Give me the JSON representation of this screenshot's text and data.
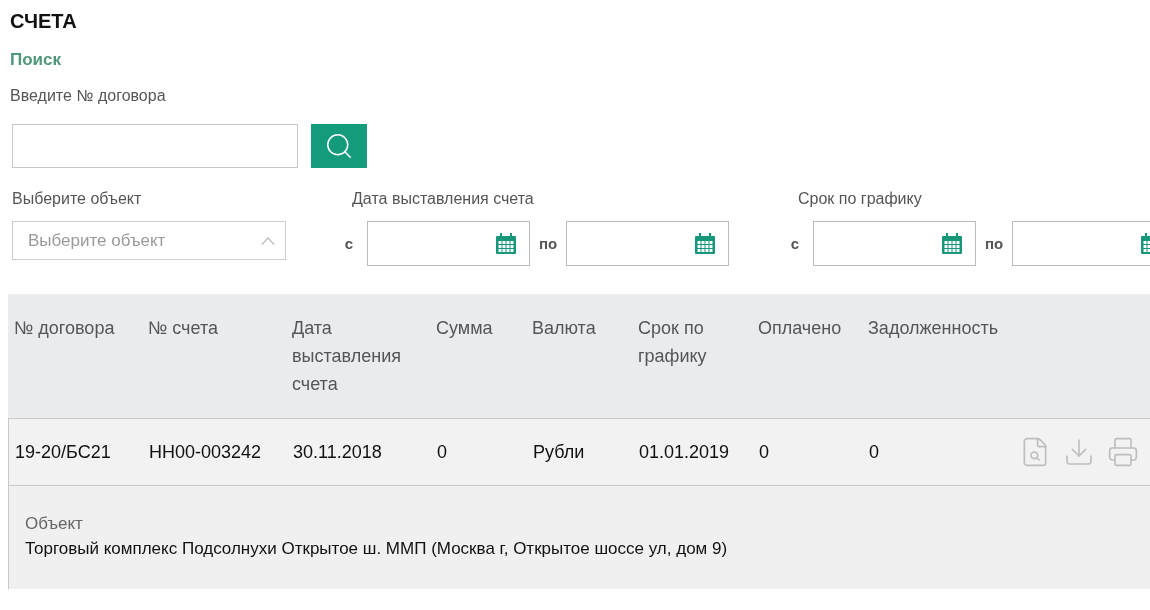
{
  "title": "СЧЕТА",
  "search": {
    "heading": "Поиск",
    "label": "Введите № договора"
  },
  "object_select": {
    "label": "Выберите объект",
    "placeholder": "Выберите объект"
  },
  "date_filters": [
    {
      "label": "Дата выставления счета",
      "from_prefix": "с",
      "to_prefix": "по"
    },
    {
      "label": "Срок по графику",
      "from_prefix": "с",
      "to_prefix": "по"
    }
  ],
  "table": {
    "columns": [
      "№ договора",
      "№ счета",
      "Дата выставления счета",
      "Сумма",
      "Валюта",
      "Срок по графику",
      "Оплачено",
      "Задолженность"
    ],
    "rows": [
      {
        "cells": [
          "19-20/БС21",
          "НН00-003242",
          "30.11.2018",
          "0",
          "Рубли",
          "01.01.2019",
          "0",
          "0"
        ],
        "detail": {
          "label": "Объект",
          "value": "Торговый комплекс Подсолнухи Открытое ш. ММП (Москва г, Открытое шоссе ул, дом 9)"
        }
      }
    ]
  }
}
